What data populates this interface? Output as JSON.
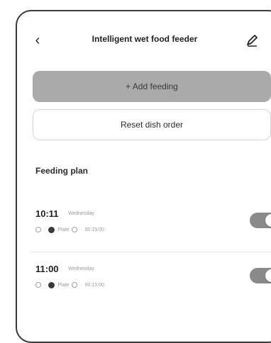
{
  "header": {
    "title": "Intelligent wet food feeder",
    "back_icon": "chevron-left-icon",
    "edit_icon": "pencil-icon"
  },
  "actions": {
    "add_label": "+ Add feeding",
    "reset_label": "Reset dish order"
  },
  "feeding_plan": {
    "title": "Feeding plan",
    "items": [
      {
        "time": "10:11",
        "day": "Wednesday",
        "plate_label": "Plate",
        "duration": "00:15:00",
        "enabled": true
      },
      {
        "time": "11:00",
        "day": "Wednesday",
        "plate_label": "Plate",
        "duration": "00:15:00",
        "enabled": true
      }
    ]
  },
  "colors": {
    "add_button": "#aaaaaa",
    "toggle_on": "#8a8a8a",
    "border": "#3a3a3a"
  }
}
